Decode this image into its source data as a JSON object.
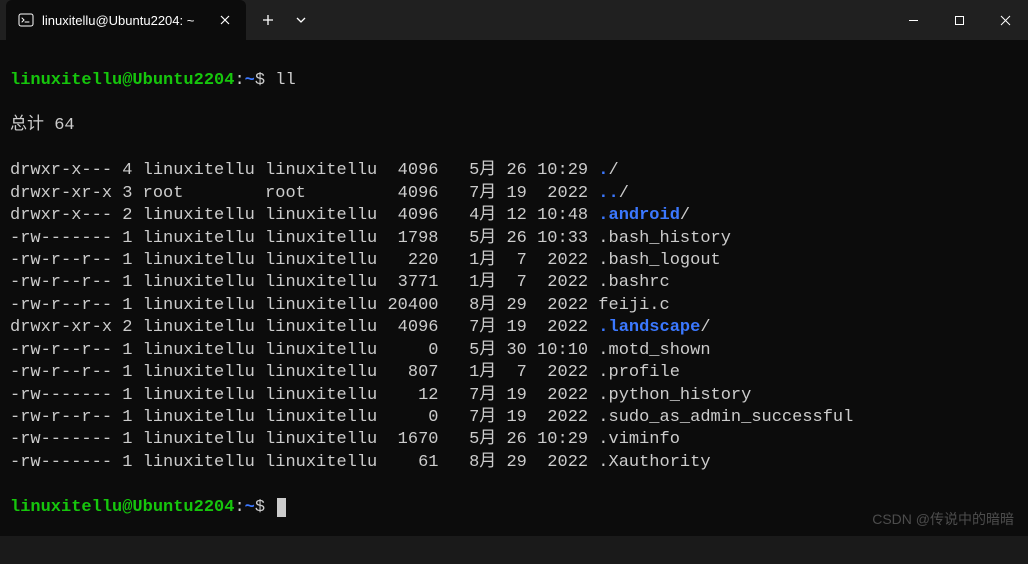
{
  "titlebar": {
    "tab_title": "linuxitellu@Ubuntu2204: ~"
  },
  "prompt": {
    "userhost": "linuxitellu@Ubuntu2204",
    "colon": ":",
    "path": "~",
    "symbol": "$",
    "command": "ll"
  },
  "total_line": "总计 64",
  "listing": [
    {
      "perms": "drwxr-x---",
      "links": "4",
      "owner": "linuxitellu",
      "group": "linuxitellu",
      "size": "4096",
      "month": "5月",
      "day": "26",
      "time": "10:29",
      "name": ".",
      "suffix": "/",
      "dir": true
    },
    {
      "perms": "drwxr-xr-x",
      "links": "3",
      "owner": "root",
      "group": "root",
      "size": "4096",
      "month": "7月",
      "day": "19",
      "time": "2022",
      "name": "..",
      "suffix": "/",
      "dir": true
    },
    {
      "perms": "drwxr-x---",
      "links": "2",
      "owner": "linuxitellu",
      "group": "linuxitellu",
      "size": "4096",
      "month": "4月",
      "day": "12",
      "time": "10:48",
      "name": ".android",
      "suffix": "/",
      "dir": true
    },
    {
      "perms": "-rw-------",
      "links": "1",
      "owner": "linuxitellu",
      "group": "linuxitellu",
      "size": "1798",
      "month": "5月",
      "day": "26",
      "time": "10:33",
      "name": ".bash_history",
      "suffix": "",
      "dir": false
    },
    {
      "perms": "-rw-r--r--",
      "links": "1",
      "owner": "linuxitellu",
      "group": "linuxitellu",
      "size": "220",
      "month": "1月",
      "day": "7",
      "time": "2022",
      "name": ".bash_logout",
      "suffix": "",
      "dir": false
    },
    {
      "perms": "-rw-r--r--",
      "links": "1",
      "owner": "linuxitellu",
      "group": "linuxitellu",
      "size": "3771",
      "month": "1月",
      "day": "7",
      "time": "2022",
      "name": ".bashrc",
      "suffix": "",
      "dir": false
    },
    {
      "perms": "-rw-r--r--",
      "links": "1",
      "owner": "linuxitellu",
      "group": "linuxitellu",
      "size": "20400",
      "month": "8月",
      "day": "29",
      "time": "2022",
      "name": "feiji.c",
      "suffix": "",
      "dir": false
    },
    {
      "perms": "drwxr-xr-x",
      "links": "2",
      "owner": "linuxitellu",
      "group": "linuxitellu",
      "size": "4096",
      "month": "7月",
      "day": "19",
      "time": "2022",
      "name": ".landscape",
      "suffix": "/",
      "dir": true
    },
    {
      "perms": "-rw-r--r--",
      "links": "1",
      "owner": "linuxitellu",
      "group": "linuxitellu",
      "size": "0",
      "month": "5月",
      "day": "30",
      "time": "10:10",
      "name": ".motd_shown",
      "suffix": "",
      "dir": false
    },
    {
      "perms": "-rw-r--r--",
      "links": "1",
      "owner": "linuxitellu",
      "group": "linuxitellu",
      "size": "807",
      "month": "1月",
      "day": "7",
      "time": "2022",
      "name": ".profile",
      "suffix": "",
      "dir": false
    },
    {
      "perms": "-rw-------",
      "links": "1",
      "owner": "linuxitellu",
      "group": "linuxitellu",
      "size": "12",
      "month": "7月",
      "day": "19",
      "time": "2022",
      "name": ".python_history",
      "suffix": "",
      "dir": false
    },
    {
      "perms": "-rw-r--r--",
      "links": "1",
      "owner": "linuxitellu",
      "group": "linuxitellu",
      "size": "0",
      "month": "7月",
      "day": "19",
      "time": "2022",
      "name": ".sudo_as_admin_successful",
      "suffix": "",
      "dir": false
    },
    {
      "perms": "-rw-------",
      "links": "1",
      "owner": "linuxitellu",
      "group": "linuxitellu",
      "size": "1670",
      "month": "5月",
      "day": "26",
      "time": "10:29",
      "name": ".viminfo",
      "suffix": "",
      "dir": false
    },
    {
      "perms": "-rw-------",
      "links": "1",
      "owner": "linuxitellu",
      "group": "linuxitellu",
      "size": "61",
      "month": "8月",
      "day": "29",
      "time": "2022",
      "name": ".Xauthority",
      "suffix": "",
      "dir": false
    }
  ],
  "watermark": "CSDN @传说中的暗暗"
}
